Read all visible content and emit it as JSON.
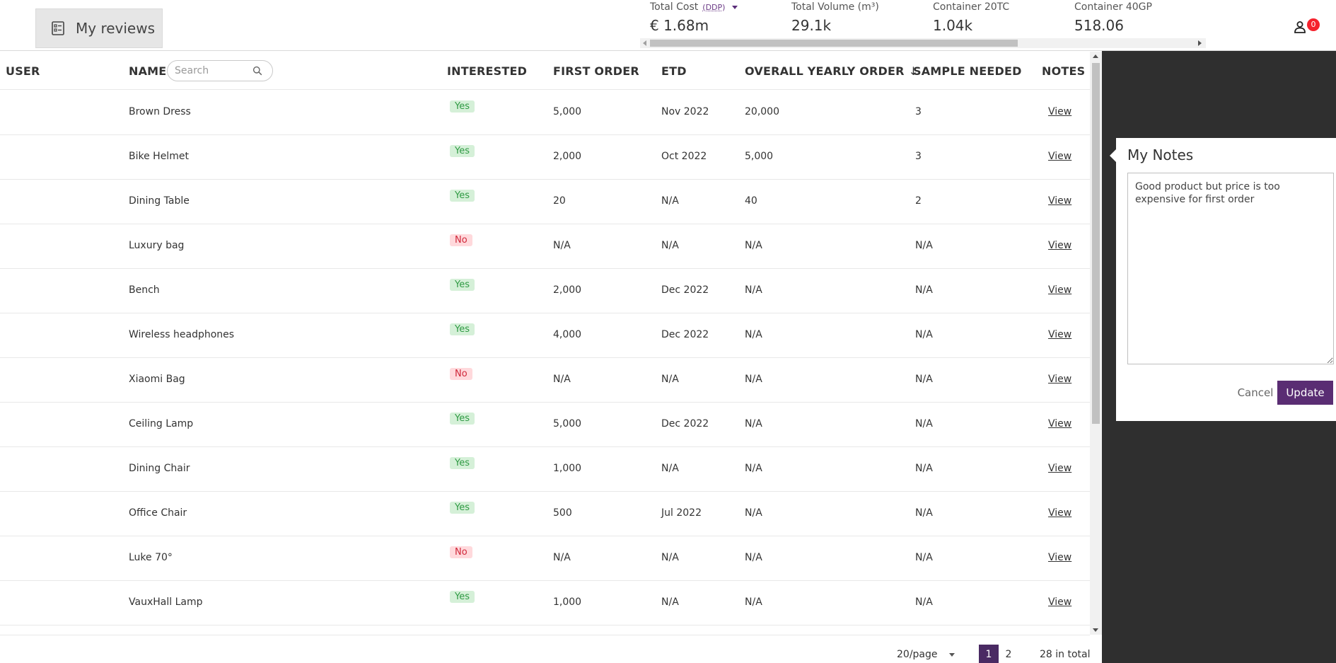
{
  "header": {
    "my_reviews_label": "My reviews",
    "stats": [
      {
        "label": "Total Cost",
        "extra": "(DDP)",
        "value": "€ 1.68m"
      },
      {
        "label": "Total Volume (m³)",
        "value": "29.1k"
      },
      {
        "label": "Container 20TC",
        "value": "1.04k"
      },
      {
        "label": "Container 40GP",
        "value": "518.06"
      }
    ],
    "notification_count": "0"
  },
  "table": {
    "columns": {
      "user": "USER",
      "name": "NAME",
      "interested": "INTERESTED",
      "first_order": "FIRST ORDER",
      "etd": "ETD",
      "overall_yearly_order": "OVERALL YEARLY ORDER",
      "sample_needed": "SAMPLE NEEDED",
      "notes": "NOTES"
    },
    "sort_indicator": "↓",
    "search_placeholder": "Search",
    "view_label": "View",
    "rows": [
      {
        "name": "Brown Dress",
        "interested": "Yes",
        "first_order": "5,000",
        "etd": "Nov 2022",
        "yearly": "20,000",
        "sample": "3"
      },
      {
        "name": "Bike Helmet",
        "interested": "Yes",
        "first_order": "2,000",
        "etd": "Oct 2022",
        "yearly": "5,000",
        "sample": "3"
      },
      {
        "name": "Dining Table",
        "interested": "Yes",
        "first_order": "20",
        "etd": "N/A",
        "yearly": "40",
        "sample": "2"
      },
      {
        "name": "Luxury bag",
        "interested": "No",
        "first_order": "N/A",
        "etd": "N/A",
        "yearly": "N/A",
        "sample": "N/A"
      },
      {
        "name": "Bench",
        "interested": "Yes",
        "first_order": "2,000",
        "etd": "Dec 2022",
        "yearly": "N/A",
        "sample": "N/A"
      },
      {
        "name": "Wireless headphones",
        "interested": "Yes",
        "first_order": "4,000",
        "etd": "Dec 2022",
        "yearly": "N/A",
        "sample": "N/A"
      },
      {
        "name": "Xiaomi Bag",
        "interested": "No",
        "first_order": "N/A",
        "etd": "N/A",
        "yearly": "N/A",
        "sample": "N/A"
      },
      {
        "name": "Ceiling Lamp",
        "interested": "Yes",
        "first_order": "5,000",
        "etd": "Dec 2022",
        "yearly": "N/A",
        "sample": "N/A"
      },
      {
        "name": "Dining Chair",
        "interested": "Yes",
        "first_order": "1,000",
        "etd": "N/A",
        "yearly": "N/A",
        "sample": "N/A"
      },
      {
        "name": "Office Chair",
        "interested": "Yes",
        "first_order": "500",
        "etd": "Jul 2022",
        "yearly": "N/A",
        "sample": "N/A"
      },
      {
        "name": "Luke 70°",
        "interested": "No",
        "first_order": "N/A",
        "etd": "N/A",
        "yearly": "N/A",
        "sample": "N/A"
      },
      {
        "name": "VauxHall Lamp",
        "interested": "Yes",
        "first_order": "1,000",
        "etd": "N/A",
        "yearly": "N/A",
        "sample": "N/A"
      }
    ]
  },
  "pagination": {
    "page_size": "20/page",
    "pages": [
      "1",
      "2"
    ],
    "current_page": "1",
    "total": "28 in total"
  },
  "notes_popover": {
    "title": "My Notes",
    "text": "Good product but price is too expensive for first order",
    "cancel_label": "Cancel",
    "update_label": "Update"
  },
  "colors": {
    "accent": "#5a2d73",
    "yes_bg": "#d5f0d8",
    "yes_fg": "#2f9a43",
    "no_bg": "#ffd9dc",
    "no_fg": "#d0283a",
    "dark_panel": "#2f2f2f"
  },
  "icons": {
    "my_reviews": "checklist-icon",
    "search": "search-icon",
    "user": "user-icon"
  }
}
